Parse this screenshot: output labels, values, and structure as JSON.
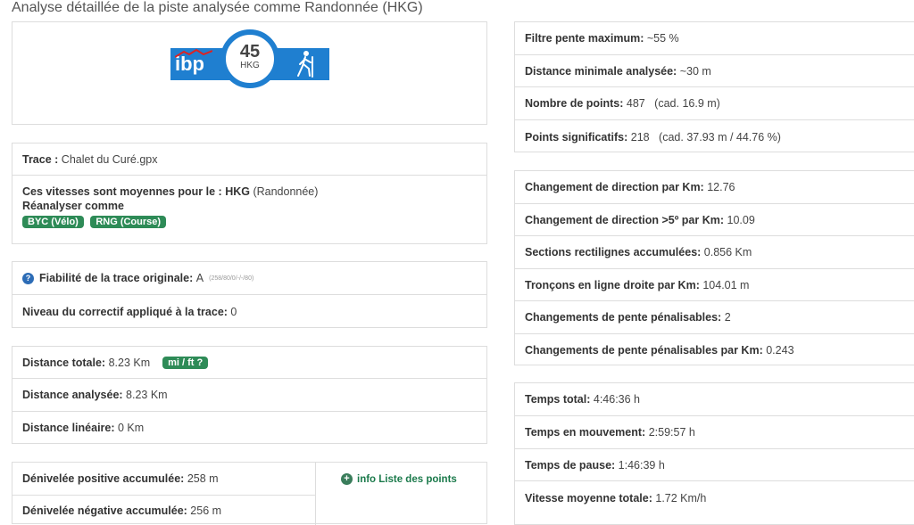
{
  "title": "Analyse détaillée de la piste analysée comme Randonnée (HKG)",
  "badge": {
    "brand": "ibp",
    "score": "45",
    "code": "HKG",
    "icon": "hiker-icon"
  },
  "trace": {
    "label": "Trace :",
    "value": "Chalet du Curé.gpx"
  },
  "speeds": {
    "label": "Ces vitesses sont moyennes pour le :",
    "code": "HKG",
    "activity": "(Randonnée)",
    "reanalyse": "Réanalyser comme",
    "buttons": [
      "BYC (Vélo)",
      "RNG (Course)"
    ]
  },
  "reliability": {
    "label": "Fiabilité de la trace originale:",
    "value": "A",
    "detail": "(258/80/0/-/-/80)"
  },
  "correction": {
    "label": "Niveau du correctif appliqué à la trace:",
    "value": "0"
  },
  "distance_total": {
    "label": "Distance totale:",
    "value": "8.23 Km",
    "unit_button": "mi / ft ?"
  },
  "distance_analysed": {
    "label": "Distance analysée:",
    "value": "8.23 Km"
  },
  "distance_linear": {
    "label": "Distance linéaire:",
    "value": "0 Km"
  },
  "elev_pos": {
    "label": "Dénivelée positive accumulée:",
    "value": "258 m"
  },
  "elev_neg": {
    "label": "Dénivelée négative accumulée:",
    "value": "256 m"
  },
  "points_link": "info Liste des points",
  "right_a": [
    {
      "label": "Filtre pente maximum:",
      "value": "~55 %"
    },
    {
      "label": "Distance minimale analysée:",
      "value": "~30 m"
    },
    {
      "label": "Nombre de points:",
      "value": "487   (cad. 16.9 m)"
    },
    {
      "label": "Points significatifs:",
      "value": "218   (cad. 37.93 m / 44.76 %)"
    }
  ],
  "right_b": [
    {
      "label": "Changement de direction par Km:",
      "value": "12.76"
    },
    {
      "label": "Changement de direction >5º par Km:",
      "value": "10.09"
    },
    {
      "label": "Sections rectilignes accumulées:",
      "value": "0.856 Km"
    },
    {
      "label": "Tronçons en ligne droite par Km:",
      "value": "104.01 m"
    },
    {
      "label": "Changements de pente pénalisables:",
      "value": "2"
    },
    {
      "label": "Changements de pente pénalisables par Km:",
      "value": "0.243"
    }
  ],
  "right_c": [
    {
      "label": "Temps total:",
      "value": "4:46:36 h"
    },
    {
      "label": "Temps en mouvement:",
      "value": "2:59:57 h"
    },
    {
      "label": "Temps de pause:",
      "value": "1:46:39 h"
    },
    {
      "label": "Vitesse moyenne totale:",
      "value": "1.72 Km/h"
    }
  ]
}
